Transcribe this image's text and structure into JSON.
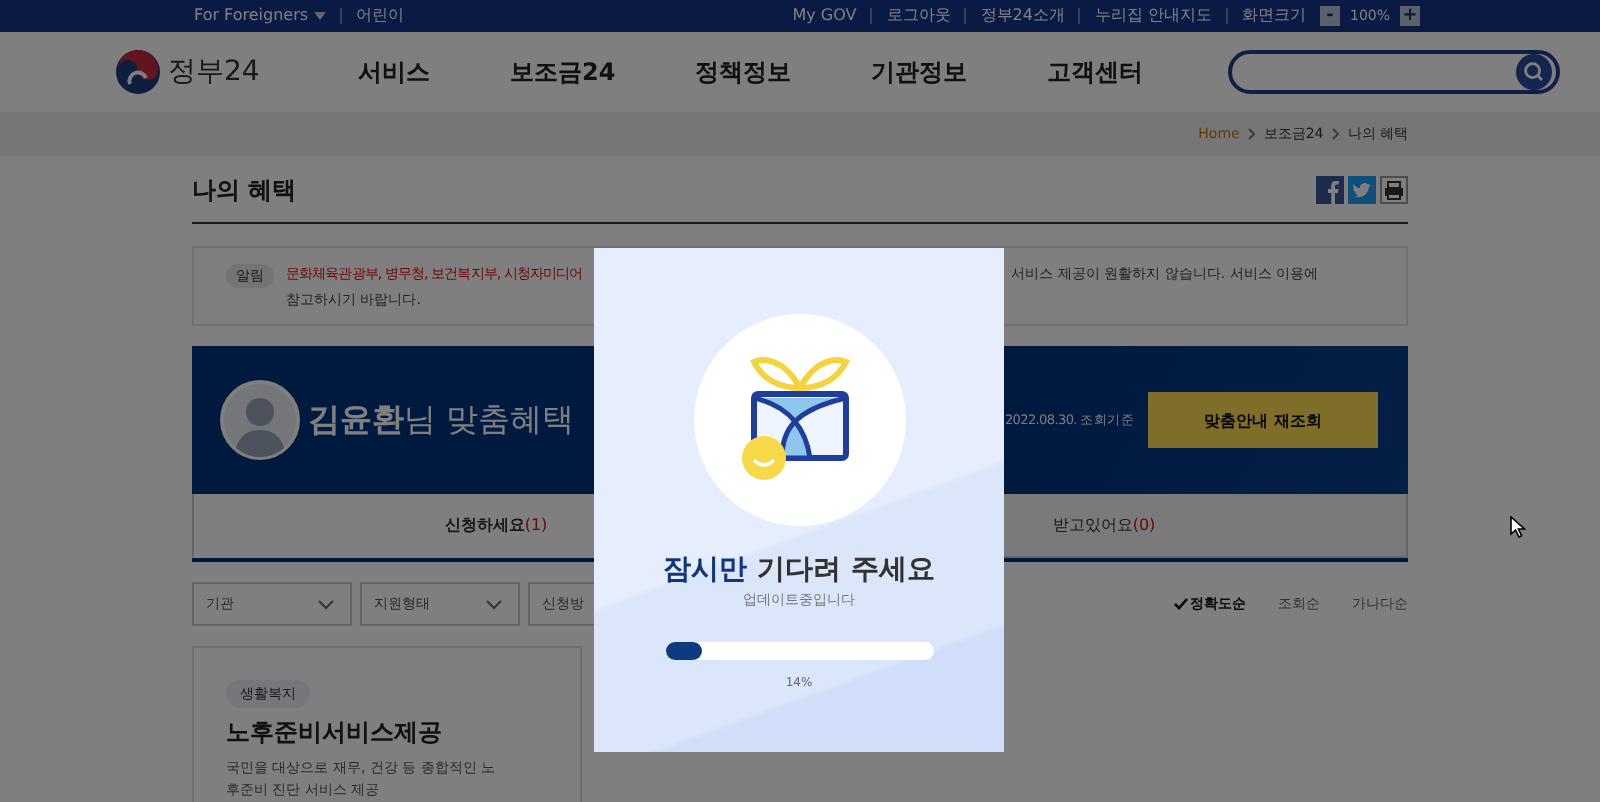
{
  "top_bar": {
    "left": [
      {
        "label": "For Foreigners",
        "dropdown": true
      },
      {
        "label": "어린이",
        "dropdown": false
      }
    ],
    "right": [
      "My GOV",
      "로그아웃",
      "정부24소개",
      "누리집 안내지도"
    ],
    "zoom": {
      "label": "화면크기",
      "minus": "-",
      "value": "100%",
      "plus": "+"
    }
  },
  "header": {
    "logo": "정부24",
    "nav": [
      "서비스",
      "보조금24",
      "정책정보",
      "기관정보",
      "고객센터"
    ]
  },
  "breadcrumb": [
    "Home",
    "보조금24",
    "나의 혜택"
  ],
  "page_title": "나의 혜택",
  "notice": {
    "badge": "알림",
    "text_left": "문화체육관광부, 병무청, 보건복지부, 시청자미디어",
    "text_right": "서비스 제공이 원활하지 않습니다. 서비스 이용에",
    "text_line2": "참고하시기 바랍니다."
  },
  "banner": {
    "title": "**김윤환**님 맞춤혜택",
    "date": "2022.08.30. 조회기준",
    "button": "맞춤안내 재조회"
  },
  "tabs": [
    {
      "label": "신청하세요",
      "count": "(1)",
      "selected": true
    },
    {
      "label": "받고있어요",
      "count": "(0)",
      "selected": false
    }
  ],
  "filters": [
    "기관",
    "지원형태",
    "신청방"
  ],
  "sort": [
    {
      "label": "정확도순",
      "selected": true
    },
    {
      "label": "조회순",
      "selected": false
    },
    {
      "label": "가나다순",
      "selected": false
    }
  ],
  "cards": [
    {
      "tag": "생활복지",
      "title": "노후준비서비스제공",
      "description": "국민을 대상으로 재무, 건강 등 종합적인 노후준비 진단 서비스 제공"
    }
  ],
  "loading": {
    "title": "**잠시만** 기다려 주세요",
    "subtitle": "업데이트중입니다",
    "level": 0.14,
    "percent": "14%"
  }
}
